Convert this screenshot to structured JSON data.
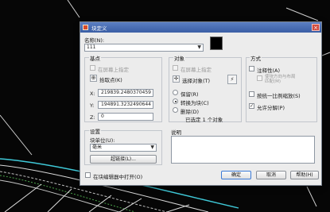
{
  "window": {
    "title": "块定义",
    "close_glyph": "×"
  },
  "name": {
    "label": "名称(N):",
    "value": "111"
  },
  "basepoint": {
    "title": "基点",
    "specify_on_screen": "在屏幕上指定",
    "pick_button": "拾取点(K)",
    "x_label": "X:",
    "x_value": "219839.2480370459",
    "y_label": "Y:",
    "y_value": "194891.3232490644",
    "z_label": "Z:",
    "z_value": "0"
  },
  "objects": {
    "title": "对象",
    "specify_on_screen": "在屏幕上指定",
    "select_button": "选择对象(T)",
    "retain": "保留(R)",
    "convert": "转换为块(C)",
    "delete": "删除(D)",
    "status": "已选定 1 个对象"
  },
  "behavior": {
    "title": "方式",
    "annotative": "注释性(A)",
    "match_orientation": "使块方向与布局匹配(M)",
    "scale_uniformly": "按统一比例缩放(S)",
    "allow_exploding": "允许分解(P)"
  },
  "settings": {
    "title": "设置",
    "block_unit_label": "块单位(U):",
    "block_unit_value": "毫米",
    "hyperlink_button": "超链接(L)..."
  },
  "description": {
    "label": "说明"
  },
  "footer": {
    "open_in_editor": "在块编辑器中打开(O)",
    "ok": "确定",
    "cancel": "取消",
    "help": "帮助(H)"
  },
  "colors": {
    "title_bar": "#3a5ea5",
    "dialog_bg": "#ececec",
    "canvas_bg": "#060606",
    "curve_cyan": "#3fc9d8"
  }
}
